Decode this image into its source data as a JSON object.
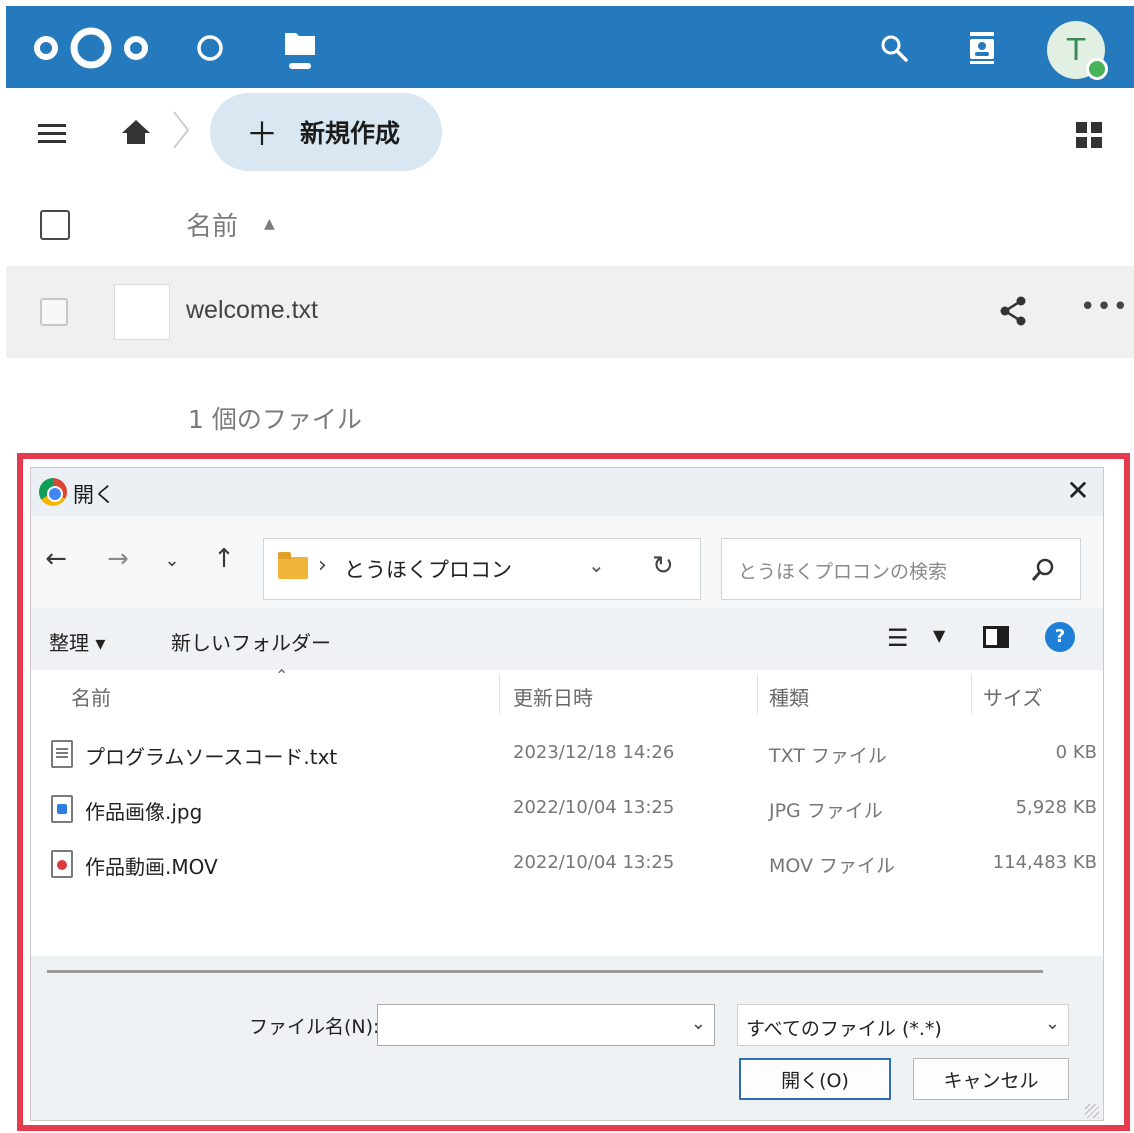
{
  "topbar": {
    "logo_icon": "nextcloud-logo",
    "nav": [
      {
        "icon": "dashboard-circle-icon"
      },
      {
        "icon": "files-folder-icon",
        "active": true
      }
    ],
    "right_icons": [
      "search-icon",
      "contacts-icon"
    ],
    "avatar_initial": "T",
    "colors": {
      "bar": "#2579bd",
      "status_online": "#49b35b"
    }
  },
  "files": {
    "new_button_label": "新規作成",
    "column_name": "名前",
    "rows": [
      {
        "name": "welcome.txt"
      }
    ],
    "summary": "1 個のファイル"
  },
  "dialog": {
    "title": "開く",
    "address": {
      "path": "とうほくプロコン"
    },
    "search_placeholder": "とうほくプロコンの検索",
    "commands": {
      "organize": "整理 ▾",
      "new_folder": "新しいフォルダー"
    },
    "columns": {
      "name": "名前",
      "modified": "更新日時",
      "type": "種類",
      "size": "サイズ"
    },
    "files": [
      {
        "name": "プログラムソースコード.txt",
        "modified": "2023/12/18 14:26",
        "type": "TXT ファイル",
        "size": "0 KB",
        "icon": "txt"
      },
      {
        "name": "作品画像.jpg",
        "modified": "2022/10/04 13:25",
        "type": "JPG ファイル",
        "size": "5,928 KB",
        "icon": "jpg"
      },
      {
        "name": "作品動画.MOV",
        "modified": "2022/10/04 13:25",
        "type": "MOV ファイル",
        "size": "114,483 KB",
        "icon": "mov"
      }
    ],
    "filename_label": "ファイル名(N):",
    "filename_value": "",
    "filetype_value": "すべてのファイル (*.*)",
    "open_button": "開く(O)",
    "cancel_button": "キャンセル",
    "highlight_color": "#e63a4f"
  }
}
